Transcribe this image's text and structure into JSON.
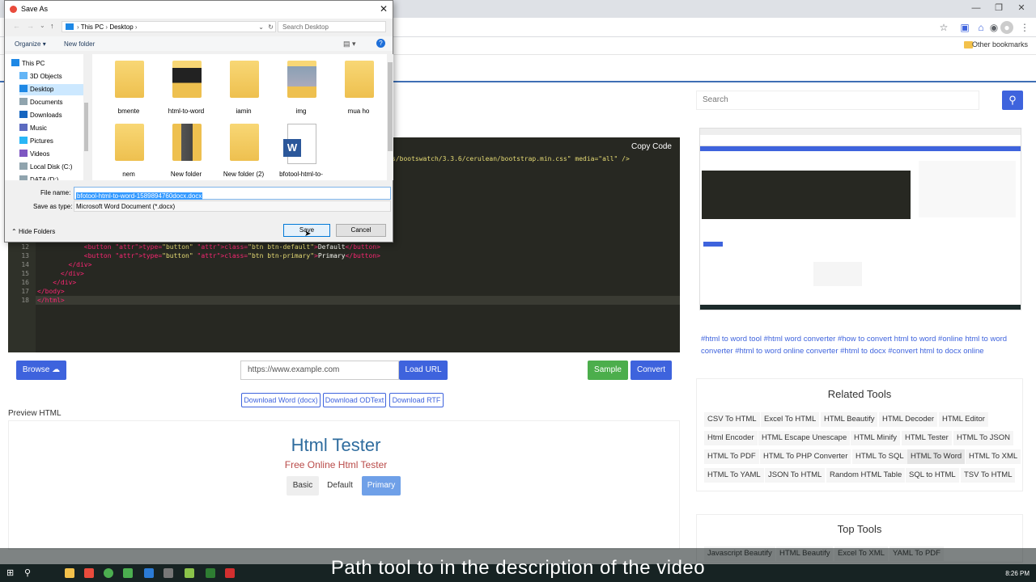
{
  "browser": {
    "bookmark_other": "Other bookmarks"
  },
  "search": {
    "placeholder": "Search"
  },
  "editor": {
    "copy_label": "Copy Code",
    "partial_line": "s/bootswatch/3.3.6/cerulean/bootstrap.min.css\" media=\"all\" />",
    "lines": [
      {
        "num": "12",
        "html": "            <button type=\"button\" class=\"btn btn-default\">Default</button>"
      },
      {
        "num": "13",
        "html": "            <button type=\"button\" class=\"btn btn-primary\">Primary</button>"
      },
      {
        "num": "14",
        "html": "        </div>"
      },
      {
        "num": "15",
        "html": "      </div>"
      },
      {
        "num": "16",
        "html": "    </div>"
      },
      {
        "num": "17",
        "html": "</body>"
      },
      {
        "num": "18",
        "html": "</html>"
      }
    ]
  },
  "controls": {
    "browse_label": "Browse",
    "url_placeholder": "https://www.example.com",
    "load_url_label": "Load URL",
    "sample_label": "Sample",
    "convert_label": "Convert",
    "download_word": "Download Word (docx)",
    "download_odt": "Download ODText",
    "download_rtf": "Download RTF"
  },
  "preview": {
    "label": "Preview HTML",
    "title": "Html Tester",
    "subtitle": "Free Online Html Tester",
    "buttons": [
      "Basic",
      "Default",
      "Primary"
    ]
  },
  "sidebar": {
    "tags": "#html to word tool  #html word converter  #how to convert html to word  #online html to word converter  #html to word online converter  #html to docx  #convert html to docx online",
    "related_title": "Related Tools",
    "related_tools": [
      "CSV To HTML",
      "Excel To HTML",
      "HTML Beautify",
      "HTML Decoder",
      "HTML Editor",
      "Html Encoder",
      "HTML Escape Unescape",
      "HTML Minify",
      "HTML Tester",
      "HTML To JSON",
      "HTML To PDF",
      "HTML To PHP Converter",
      "HTML To SQL",
      "HTML To Word",
      "HTML To XML",
      "HTML To YAML",
      "JSON To HTML",
      "Random HTML Table",
      "SQL to HTML",
      "TSV To HTML"
    ],
    "top_title": "Top Tools",
    "top_tools": [
      "Javascript Beautify",
      "HTML Beautify",
      "Excel To XML",
      "YAML To PDF"
    ]
  },
  "dialog": {
    "title": "Save As",
    "breadcrumb": [
      "This PC",
      "Desktop"
    ],
    "search_placeholder": "Search Desktop",
    "organize": "Organize",
    "new_folder": "New folder",
    "nav": [
      "This PC",
      "3D Objects",
      "Desktop",
      "Documents",
      "Downloads",
      "Music",
      "Pictures",
      "Videos",
      "Local Disk (C:)",
      "DATA (D:)"
    ],
    "files": [
      "bmente",
      "html-to-word",
      "iamin",
      "img",
      "mua ho",
      "nem",
      "New folder",
      "New folder (2)",
      "bfotool-html-to-"
    ],
    "file_name_label": "File name:",
    "file_name": "bfotool-html-to-word-1589894760docx.docx",
    "save_as_type_label": "Save as type:",
    "save_as_type": "Microsoft Word Document (*.docx)",
    "hide_folders": "Hide Folders",
    "save": "Save",
    "cancel": "Cancel"
  },
  "caption": "Path tool to in the description of the video",
  "taskbar": {
    "time": "8:26 PM"
  },
  "colors": {
    "accent": "#3e63dd",
    "success": "#4cae4c",
    "editor_bg": "#272822"
  }
}
